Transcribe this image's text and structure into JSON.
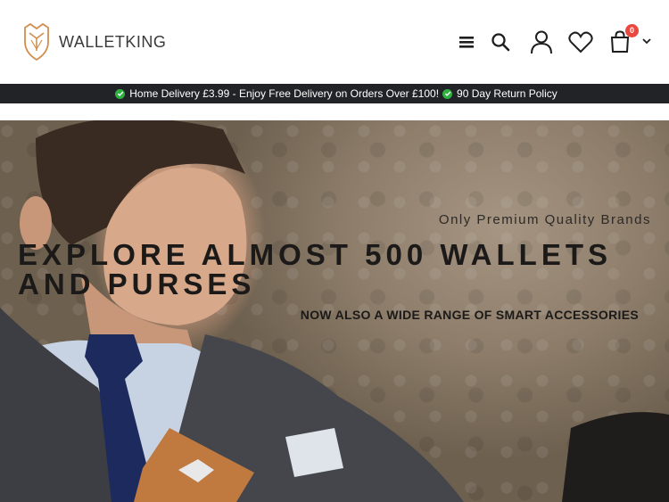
{
  "brand": {
    "name": "WALLETKING"
  },
  "header": {
    "icons": [
      "menu-icon",
      "search-icon",
      "user-icon",
      "heart-icon",
      "cart-icon",
      "chevron-down-icon"
    ],
    "cart_count": "0"
  },
  "promo": {
    "text_1": "Home Delivery £3.99 - Enjoy Free Delivery on Orders Over £100!",
    "text_2": "90 Day Return Policy",
    "check_color": "#2fb140"
  },
  "hero": {
    "tagline": "Only Premium Quality Brands",
    "headline": "EXPLORE ALMOST 500 WALLETS AND PURSES",
    "subline": "NOW ALSO A WIDE RANGE OF SMART ACCESSORIES"
  },
  "colors": {
    "accent": "#d18f4f",
    "badge": "#e8483f",
    "promo_bg": "#222326"
  }
}
